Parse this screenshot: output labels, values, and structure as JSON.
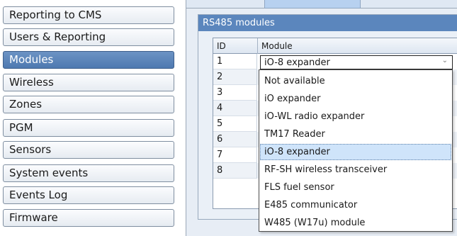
{
  "sidebar": {
    "items": [
      {
        "label": "Reporting to CMS",
        "active": false
      },
      {
        "label": "Users & Reporting",
        "active": false
      },
      {
        "label": "Modules",
        "active": true
      },
      {
        "label": "Wireless",
        "active": false
      },
      {
        "label": "Zones",
        "active": false
      },
      {
        "label": "PGM",
        "active": false
      },
      {
        "label": "Sensors",
        "active": false
      },
      {
        "label": "System events",
        "active": false
      },
      {
        "label": "Events Log",
        "active": false
      },
      {
        "label": "Firmware",
        "active": false
      }
    ]
  },
  "group": {
    "title": "RS485 modules"
  },
  "grid": {
    "columns": [
      "ID",
      "Module"
    ],
    "rows": [
      "1",
      "2",
      "3",
      "4",
      "5",
      "6",
      "7",
      "8"
    ]
  },
  "combo": {
    "value": "iO-8 expander",
    "arrow_icon": "chevron-down-icon"
  },
  "dropdown": {
    "selected_index": 5,
    "options": [
      "Not available",
      "iO expander",
      "iO-WL radio expander",
      "TM17 Reader",
      "iO-8 expander",
      "RF-SH wireless transceiver",
      "FLS fuel sensor",
      "E485 communicator",
      "W485 (W17u) module"
    ]
  },
  "colors": {
    "active_nav": "#5a86bf",
    "group_header": "#5b86bd",
    "selection": "#cfe4fa"
  }
}
